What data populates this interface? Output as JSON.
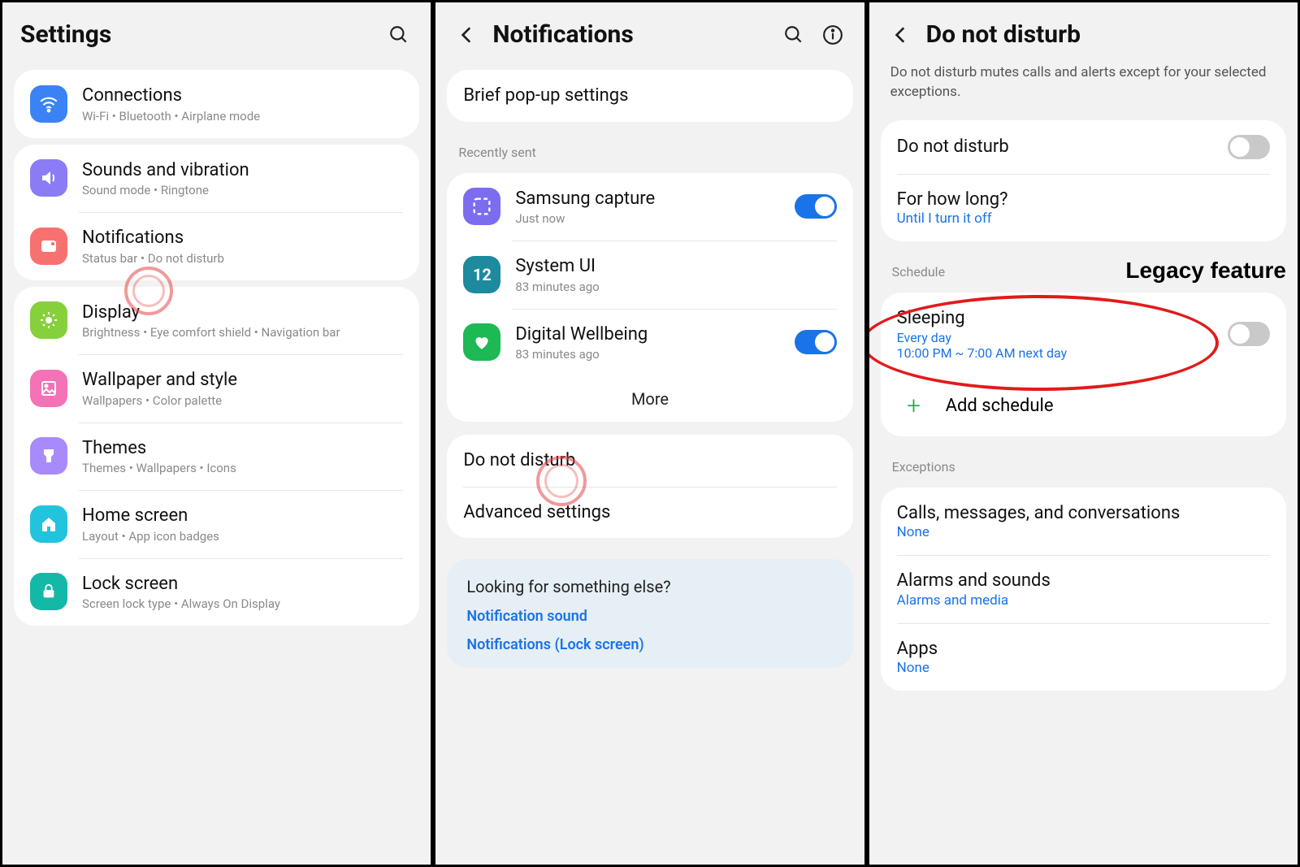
{
  "panel1": {
    "title": "Settings",
    "groups": [
      [
        {
          "id": "connections",
          "label": "Connections",
          "sub": "Wi-Fi  •  Bluetooth  •  Airplane mode",
          "color": "#3b82f6"
        }
      ],
      [
        {
          "id": "sounds",
          "label": "Sounds and vibration",
          "sub": "Sound mode  •  Ringtone",
          "color": "#8b7cf6"
        },
        {
          "id": "notifications",
          "label": "Notifications",
          "sub": "Status bar  •  Do not disturb",
          "color": "#f87171"
        }
      ],
      [
        {
          "id": "display",
          "label": "Display",
          "sub": "Brightness  •  Eye comfort shield  •  Navigation bar",
          "color": "#86d03c"
        },
        {
          "id": "wallpaper",
          "label": "Wallpaper and style",
          "sub": "Wallpapers  •  Color palette",
          "color": "#f472b6"
        },
        {
          "id": "themes",
          "label": "Themes",
          "sub": "Themes  •  Wallpapers  •  Icons",
          "color": "#a78bfa"
        },
        {
          "id": "homescreen",
          "label": "Home screen",
          "sub": "Layout  •  App icon badges",
          "color": "#22c3dd"
        },
        {
          "id": "lockscreen",
          "label": "Lock screen",
          "sub": "Screen lock type  •  Always On Display",
          "color": "#14b8a6"
        }
      ]
    ]
  },
  "panel2": {
    "title": "Notifications",
    "briefRow": "Brief pop-up settings",
    "recentlyHeader": "Recently sent",
    "recent": [
      {
        "id": "samsungcapture",
        "label": "Samsung capture",
        "sub": "Just now",
        "color": "#7c6cf0",
        "toggle": true
      },
      {
        "id": "systemui",
        "label": "System UI",
        "sub": "83 minutes ago",
        "color": "#1d8a9e"
      },
      {
        "id": "digitalwellbeing",
        "label": "Digital Wellbeing",
        "sub": "83 minutes ago",
        "color": "#1db954",
        "toggle": true
      }
    ],
    "moreLabel": "More",
    "simple": [
      {
        "id": "dnd",
        "label": "Do not disturb"
      },
      {
        "id": "advanced",
        "label": "Advanced settings"
      }
    ],
    "suggest": {
      "q": "Looking for something else?",
      "links": [
        "Notification sound",
        "Notifications (Lock screen)"
      ]
    }
  },
  "panel3": {
    "title": "Do not disturb",
    "desc": "Do not disturb mutes calls and alerts except for your selected exceptions.",
    "mainToggle": {
      "label": "Do not disturb",
      "on": false
    },
    "howLong": {
      "label": "For how long?",
      "value": "Until I turn it off"
    },
    "scheduleHeader": "Schedule",
    "sleeping": {
      "label": "Sleeping",
      "line1": "Every day",
      "line2": "10:00 PM ~ 7:00 AM next day",
      "on": false
    },
    "addSchedule": "Add schedule",
    "exceptionsHeader": "Exceptions",
    "exceptions": [
      {
        "id": "calls",
        "label": "Calls, messages, and conversations",
        "value": "None"
      },
      {
        "id": "alarms",
        "label": "Alarms and sounds",
        "value": "Alarms and media"
      },
      {
        "id": "apps",
        "label": "Apps",
        "value": "None"
      }
    ],
    "legacyLabel": "Legacy feature"
  }
}
